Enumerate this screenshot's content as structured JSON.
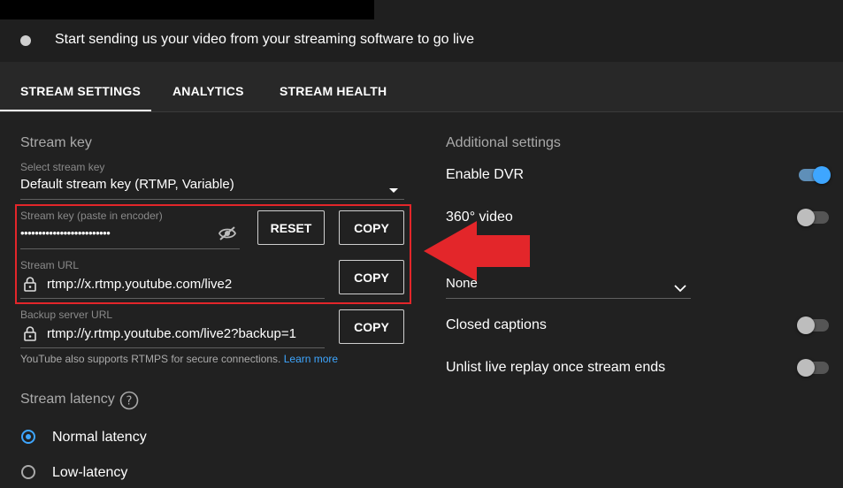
{
  "status": {
    "text": "Start sending us your video from your streaming software to go live"
  },
  "tabs": [
    {
      "label": "STREAM SETTINGS"
    },
    {
      "label": "ANALYTICS"
    },
    {
      "label": "STREAM HEALTH"
    }
  ],
  "stream_key_section": {
    "title": "Stream key",
    "select_label": "Select stream key",
    "select_value": "Default stream key (RTMP, Variable)",
    "key_label": "Stream key (paste in encoder)",
    "key_value": "•••••••••••••••••••••••••",
    "reset_label": "RESET",
    "copy_label": "COPY",
    "url_label": "Stream URL",
    "url_value": "rtmp://x.rtmp.youtube.com/live2",
    "backup_label": "Backup server URL",
    "backup_value": "rtmp://y.rtmp.youtube.com/live2?backup=1",
    "rtmps_text": "YouTube also supports RTMPS for secure connections.",
    "learn_more": "Learn more"
  },
  "latency_section": {
    "title": "Stream latency",
    "options": [
      {
        "label": "Normal latency",
        "checked": true
      },
      {
        "label": "Low-latency",
        "checked": false
      }
    ]
  },
  "additional_settings": {
    "title": "Additional settings",
    "enable_dvr": {
      "label": "Enable DVR",
      "on": true
    },
    "video_360": {
      "label": "360° video",
      "on": false
    },
    "select_value": "None",
    "closed_captions": {
      "label": "Closed captions",
      "on": false
    },
    "unlist_replay": {
      "label": "Unlist live replay once stream ends",
      "on": false
    }
  },
  "colors": {
    "background": "#212121",
    "accent_blue": "#3ea6ff",
    "highlight_red": "#e3262a"
  }
}
